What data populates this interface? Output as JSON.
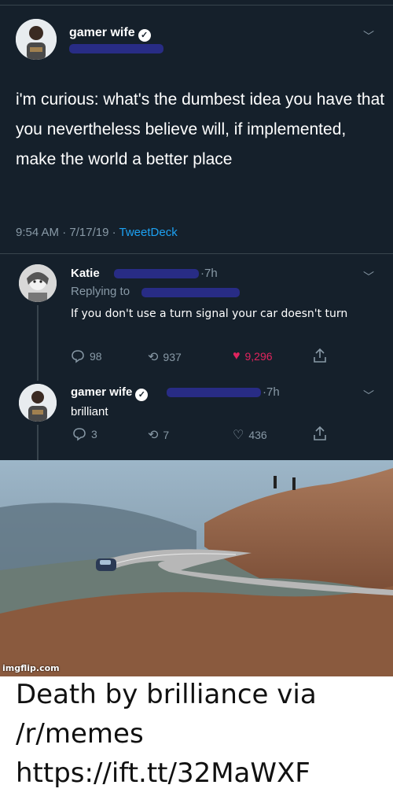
{
  "tweet": {
    "author_name": "gamer wife",
    "text": "i'm curious: what's the dumbest idea you have that you nevertheless believe will, if implemented, make the world a better place",
    "meta_time": "9:54 AM",
    "meta_date": "7/17/19",
    "meta_client": "TweetDeck",
    "sep": "·"
  },
  "reply1": {
    "author_name": "Katie",
    "time": "7h",
    "replying_to_label": "Replying to",
    "text": "If you don't use a turn signal your car doesn't turn",
    "replies": "98",
    "retweets": "937",
    "likes": "9,296"
  },
  "reply2": {
    "author_name": "gamer wife",
    "time": "7h",
    "text": "brilliant",
    "replies": "3",
    "retweets": "7",
    "likes": "436"
  },
  "image": {
    "watermark": "imgflip.com"
  },
  "caption": "Death by brilliance via /r/memes https://ift.tt/32MaWXF",
  "colors": {
    "background": "#15202b",
    "like_red": "#e0245e",
    "link_blue": "#1da1f2",
    "muted": "#8899a6"
  },
  "icons": [
    "reply-icon",
    "retweet-icon",
    "like-icon",
    "share-icon",
    "chevron-down-icon",
    "verified-icon"
  ]
}
